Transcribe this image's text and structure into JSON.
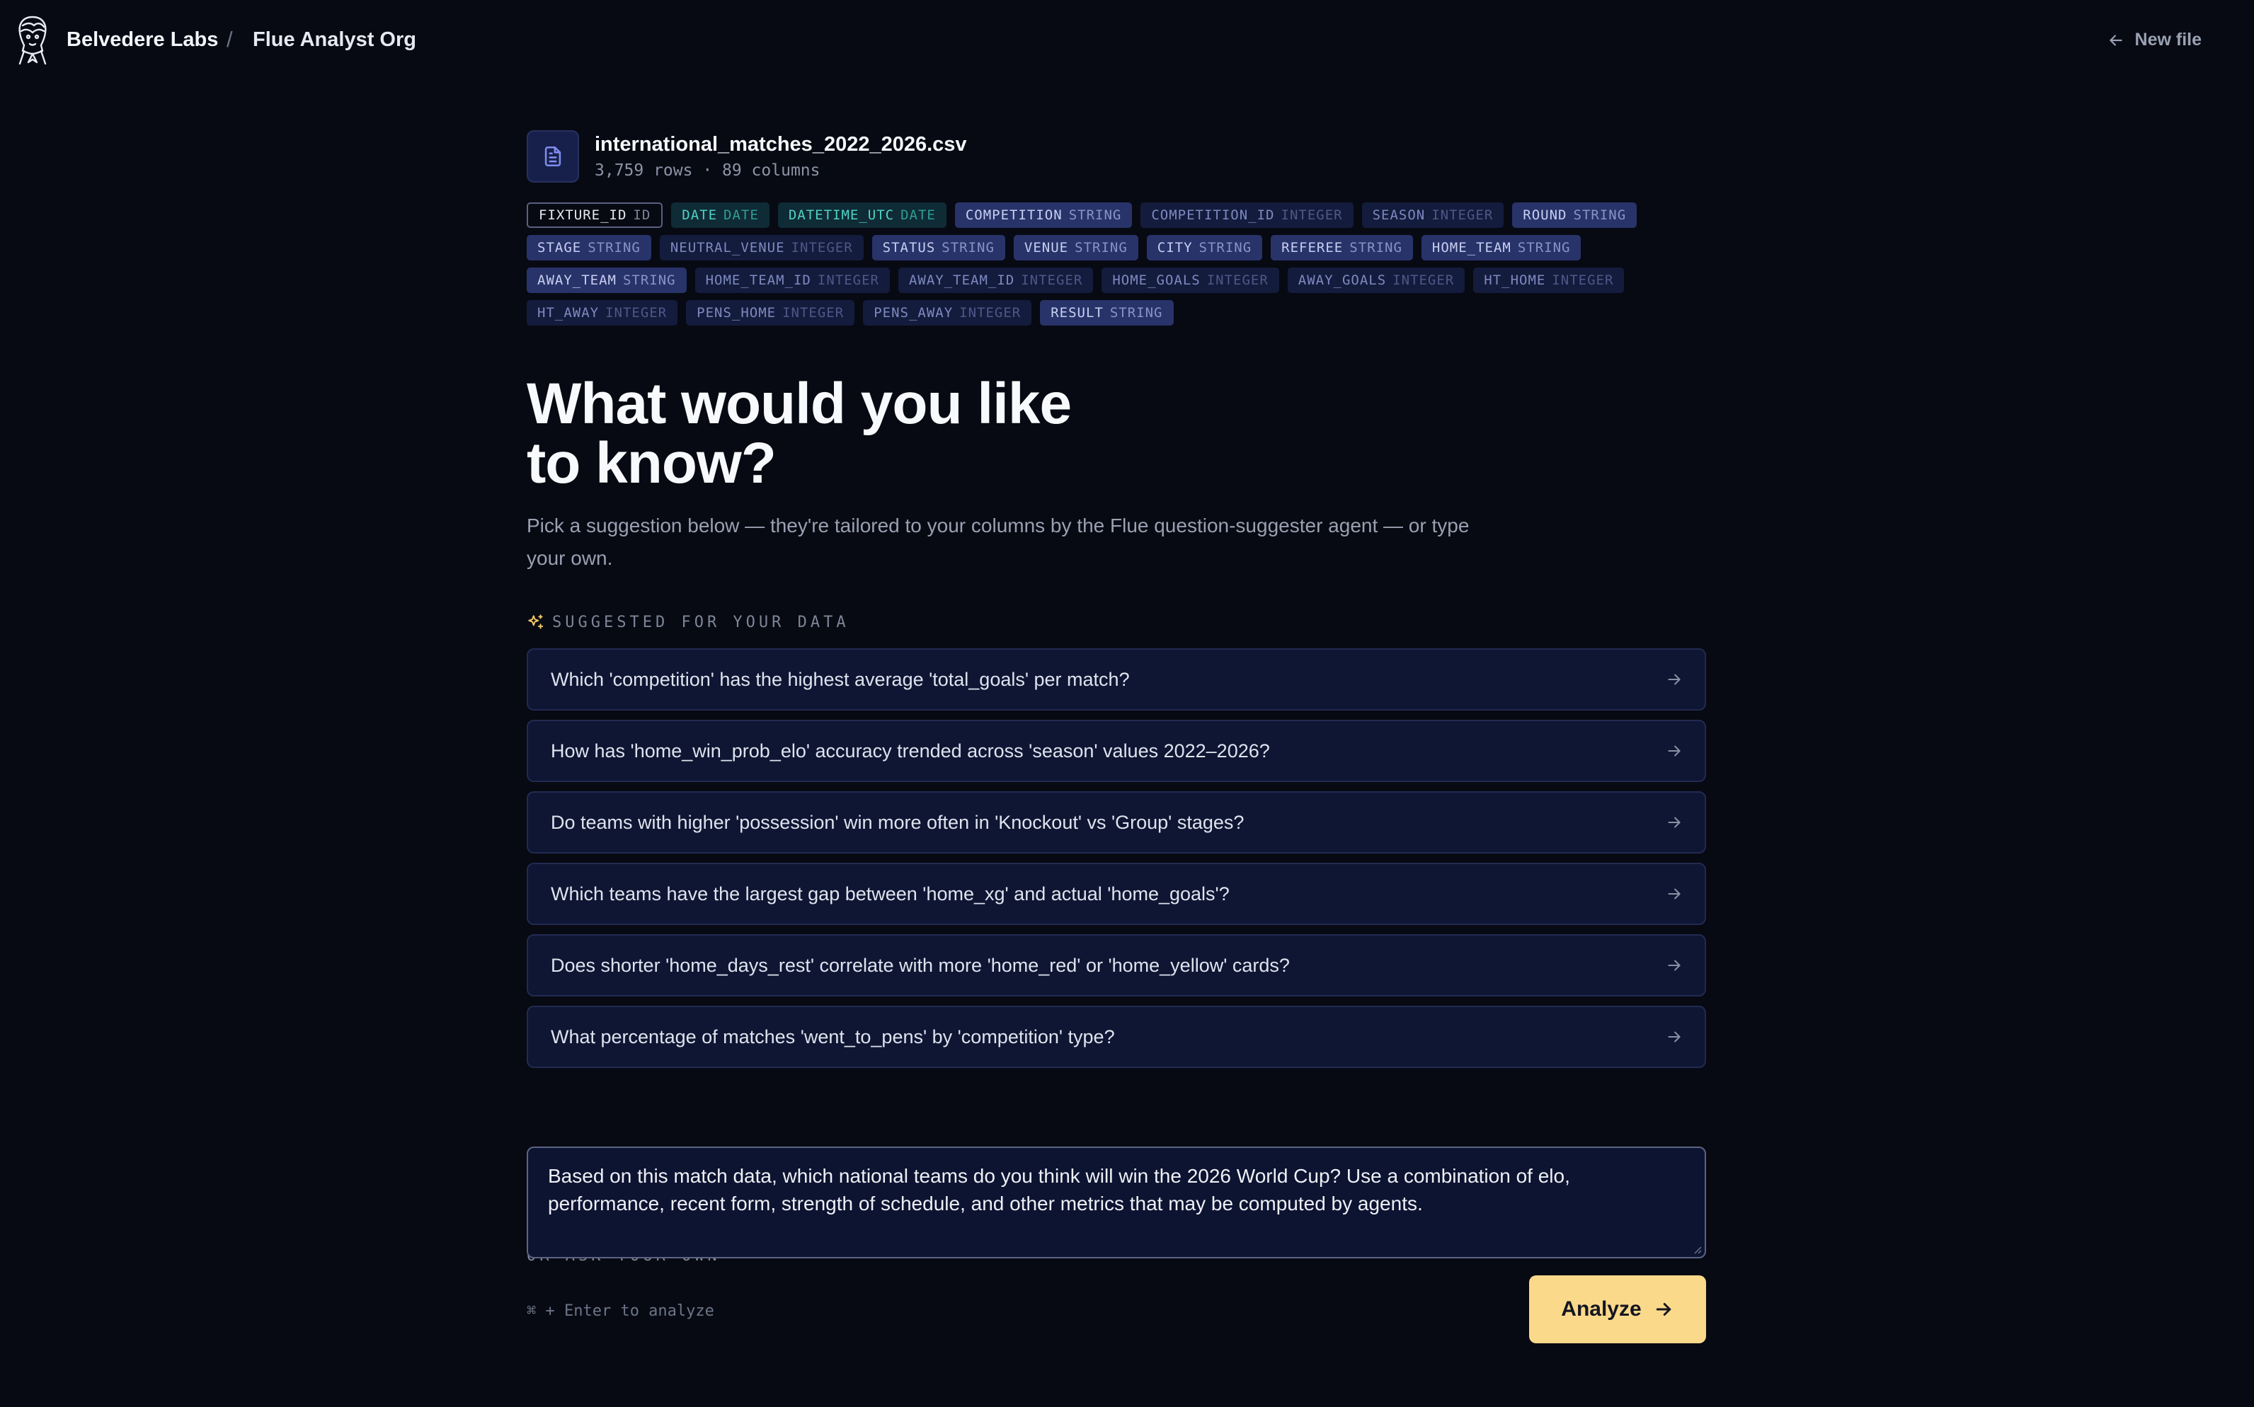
{
  "header": {
    "org": "Belvedere Labs",
    "separator": "/",
    "project": "Flue Analyst Org",
    "new_file": "New file"
  },
  "file": {
    "name": "international_matches_2022_2026.csv",
    "meta": "3,759 rows · 89 columns"
  },
  "columns": [
    {
      "name": "FIXTURE_ID",
      "type": "ID"
    },
    {
      "name": "DATE",
      "type": "DATE"
    },
    {
      "name": "DATETIME_UTC",
      "type": "DATE"
    },
    {
      "name": "COMPETITION",
      "type": "STRING"
    },
    {
      "name": "COMPETITION_ID",
      "type": "INTEGER"
    },
    {
      "name": "SEASON",
      "type": "INTEGER"
    },
    {
      "name": "ROUND",
      "type": "STRING"
    },
    {
      "name": "STAGE",
      "type": "STRING"
    },
    {
      "name": "NEUTRAL_VENUE",
      "type": "INTEGER"
    },
    {
      "name": "STATUS",
      "type": "STRING"
    },
    {
      "name": "VENUE",
      "type": "STRING"
    },
    {
      "name": "CITY",
      "type": "STRING"
    },
    {
      "name": "REFEREE",
      "type": "STRING"
    },
    {
      "name": "HOME_TEAM",
      "type": "STRING"
    },
    {
      "name": "AWAY_TEAM",
      "type": "STRING"
    },
    {
      "name": "HOME_TEAM_ID",
      "type": "INTEGER"
    },
    {
      "name": "AWAY_TEAM_ID",
      "type": "INTEGER"
    },
    {
      "name": "HOME_GOALS",
      "type": "INTEGER"
    },
    {
      "name": "AWAY_GOALS",
      "type": "INTEGER"
    },
    {
      "name": "HT_HOME",
      "type": "INTEGER"
    },
    {
      "name": "HT_AWAY",
      "type": "INTEGER"
    },
    {
      "name": "PENS_HOME",
      "type": "INTEGER"
    },
    {
      "name": "PENS_AWAY",
      "type": "INTEGER"
    },
    {
      "name": "RESULT",
      "type": "STRING"
    }
  ],
  "hero": {
    "line1": "What would you like",
    "line2": "to know?",
    "subtitle": "Pick a suggestion below — they're tailored to your columns by the Flue question-suggester agent — or type your own."
  },
  "suggested_label": "SUGGESTED FOR YOUR DATA",
  "suggestions": [
    "Which 'competition' has the highest average 'total_goals' per match?",
    "How has 'home_win_prob_elo' accuracy trended across 'season' values 2022–2026?",
    "Do teams with higher 'possession' win more often in 'Knockout' vs 'Group' stages?",
    "Which teams have the largest gap between 'home_xg' and actual 'home_goals'?",
    "Does shorter 'home_days_rest' correlate with more 'home_red' or 'home_yellow' cards?",
    "What percentage of matches 'went_to_pens' by 'competition' type?"
  ],
  "ask": {
    "label": "OR ASK YOUR OWN",
    "value": "Based on this match data, which national teams do you think will win the 2026 World Cup? Use a combination of elo, performance, recent form, strength of schedule, and other metrics that may be computed by agents.",
    "hint": "⌘ + Enter to analyze",
    "button": "Analyze"
  },
  "colors": {
    "background": "#070a12",
    "accent": "#fbd98a",
    "card": "#0e1633"
  }
}
